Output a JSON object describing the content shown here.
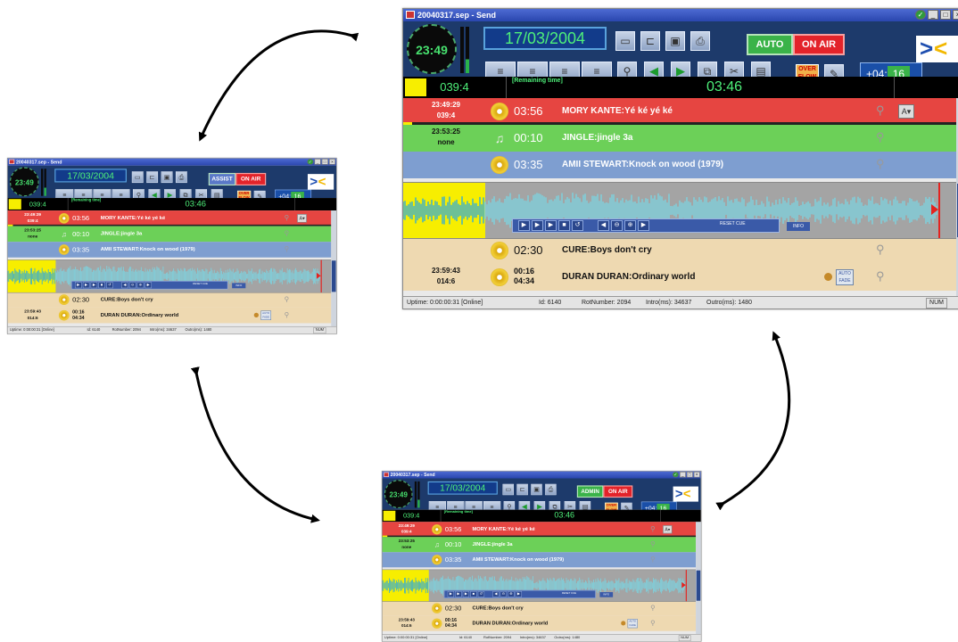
{
  "arrows": [
    "arrow-top-left",
    "arrow-top-right",
    "arrow-bottom-left",
    "arrow-bottom-right"
  ],
  "windows": [
    {
      "id": "main",
      "title": "20040317.sep - Send",
      "clock": "23:49",
      "date": "17/03/2004",
      "mode": "AUTO",
      "mode_color": "#3ab349",
      "on_air": "ON AIR",
      "overflow": "OVER FLOW",
      "offset_prefix": "+04",
      "offset_suffix": "16",
      "position": "039:4",
      "remaining_label": "[Remaining time]",
      "remaining_time": "03:46",
      "rows": [
        {
          "time1": "23:49:29",
          "time2": "039:4",
          "duration": "03:56",
          "title": "MORY KANTE:Yé ké yé ké",
          "style": "red",
          "ab": "A▾"
        },
        {
          "time1": "23:53:25",
          "time2": "none",
          "duration": "00:10",
          "title": "JINGLE:jingle 3a",
          "style": "green"
        },
        {
          "time1": "",
          "time2": "",
          "duration": "03:35",
          "title": "AMII STEWART:Knock on wood (1979)",
          "style": "blue"
        },
        {
          "time1": "",
          "time2": "",
          "duration": "02:30",
          "title": "CURE:Boys don't cry",
          "style": "tan"
        },
        {
          "time1": "23:59:43",
          "time2": "014:6",
          "duration": "00:16",
          "duration2": "04:34",
          "title": "DURAN DURAN:Ordinary world",
          "style": "tan",
          "afade": "AUTO FADE"
        }
      ],
      "wave_reset": "RESET CUE",
      "wave_zoom": "INFO",
      "status": {
        "uptime": "Uptime: 0:00:00:31 [Online]",
        "id": "Id: 6140",
        "rotnumber": "RotNumber: 2094",
        "intro": "Intro(ms): 34637",
        "outro": "Outro(ms): 1480",
        "num": "NUM"
      }
    },
    {
      "id": "assist",
      "title": "20040317.sep - Send",
      "clock": "23:49",
      "date": "17/03/2004",
      "mode": "ASSIST",
      "mode_color": "#5a78c8",
      "on_air": "ON AIR",
      "overflow": "OVER FLOW",
      "offset_prefix": "+04",
      "offset_suffix": "16",
      "position": "039:4",
      "remaining_label": "[Remaining time]",
      "remaining_time": "03:46",
      "rows": [
        {
          "time1": "23:49:29",
          "time2": "039:4",
          "duration": "03:56",
          "title": "MORY KANTE:Yé ké yé ké",
          "style": "red",
          "ab": "A▾"
        },
        {
          "time1": "23:53:25",
          "time2": "none",
          "duration": "00:10",
          "title": "JINGLE:jingle 3a",
          "style": "green"
        },
        {
          "time1": "",
          "time2": "",
          "duration": "03:35",
          "title": "AMII STEWART:Knock on wood (1979)",
          "style": "blue"
        },
        {
          "time1": "",
          "time2": "",
          "duration": "02:30",
          "title": "CURE:Boys don't cry",
          "style": "tan"
        },
        {
          "time1": "23:59:43",
          "time2": "014:6",
          "duration": "00:16",
          "duration2": "04:34",
          "title": "DURAN DURAN:Ordinary world",
          "style": "tan",
          "afade": "AUTO FADE"
        }
      ],
      "wave_reset": "RESET CUE",
      "wave_zoom": "INFO",
      "status": {
        "uptime": "Uptime: 0:00:00:31 [Online]",
        "id": "Id: 6140",
        "rotnumber": "RotNumber: 2094",
        "intro": "Intro(ms): 34637",
        "outro": "Outro(ms): 1480",
        "num": "NUM"
      }
    },
    {
      "id": "admin",
      "title": "20040317.sep - Send",
      "clock": "23:49",
      "date": "17/03/2004",
      "mode": "ADMIN",
      "mode_color": "#3ab349",
      "on_air": "ON AIR",
      "overflow": "OVER FLOW",
      "offset_prefix": "+04",
      "offset_suffix": "16",
      "position": "039:4",
      "remaining_label": "[Remaining time]",
      "remaining_time": "03:46",
      "rows": [
        {
          "time1": "23:49:29",
          "time2": "039:4",
          "duration": "03:56",
          "title": "MORY KANTE:Yé ké yé ké",
          "style": "red",
          "ab": "A▾"
        },
        {
          "time1": "23:53:25",
          "time2": "none",
          "duration": "00:10",
          "title": "JINGLE:jingle 3a",
          "style": "green"
        },
        {
          "time1": "",
          "time2": "",
          "duration": "03:35",
          "title": "AMII STEWART:Knock on wood (1979)",
          "style": "blue"
        },
        {
          "time1": "",
          "time2": "",
          "duration": "02:30",
          "title": "CURE:Boys don't cry",
          "style": "tan"
        },
        {
          "time1": "23:59:43",
          "time2": "014:6",
          "duration": "00:16",
          "duration2": "04:34",
          "title": "DURAN DURAN:Ordinary world",
          "style": "tan",
          "afade": "AUTO FADE"
        }
      ],
      "wave_reset": "RESET CUE",
      "wave_zoom": "INFO",
      "status": {
        "uptime": "Uptime: 0:00:00:31 [Online]",
        "id": "Id: 6140",
        "rotnumber": "RotNumber: 2094",
        "intro": "Intro(ms): 34637",
        "outro": "Outro(ms): 1480",
        "num": "NUM"
      }
    }
  ],
  "toolbar_icons": [
    "new-file-icon",
    "open-folder-icon",
    "save-icon",
    "print-icon",
    "list-icon",
    "list-icon",
    "list-icon",
    "list-icon",
    "zoom-icon",
    "prev-icon",
    "next-icon",
    "copy-icon",
    "cut-icon",
    "paste-icon"
  ]
}
